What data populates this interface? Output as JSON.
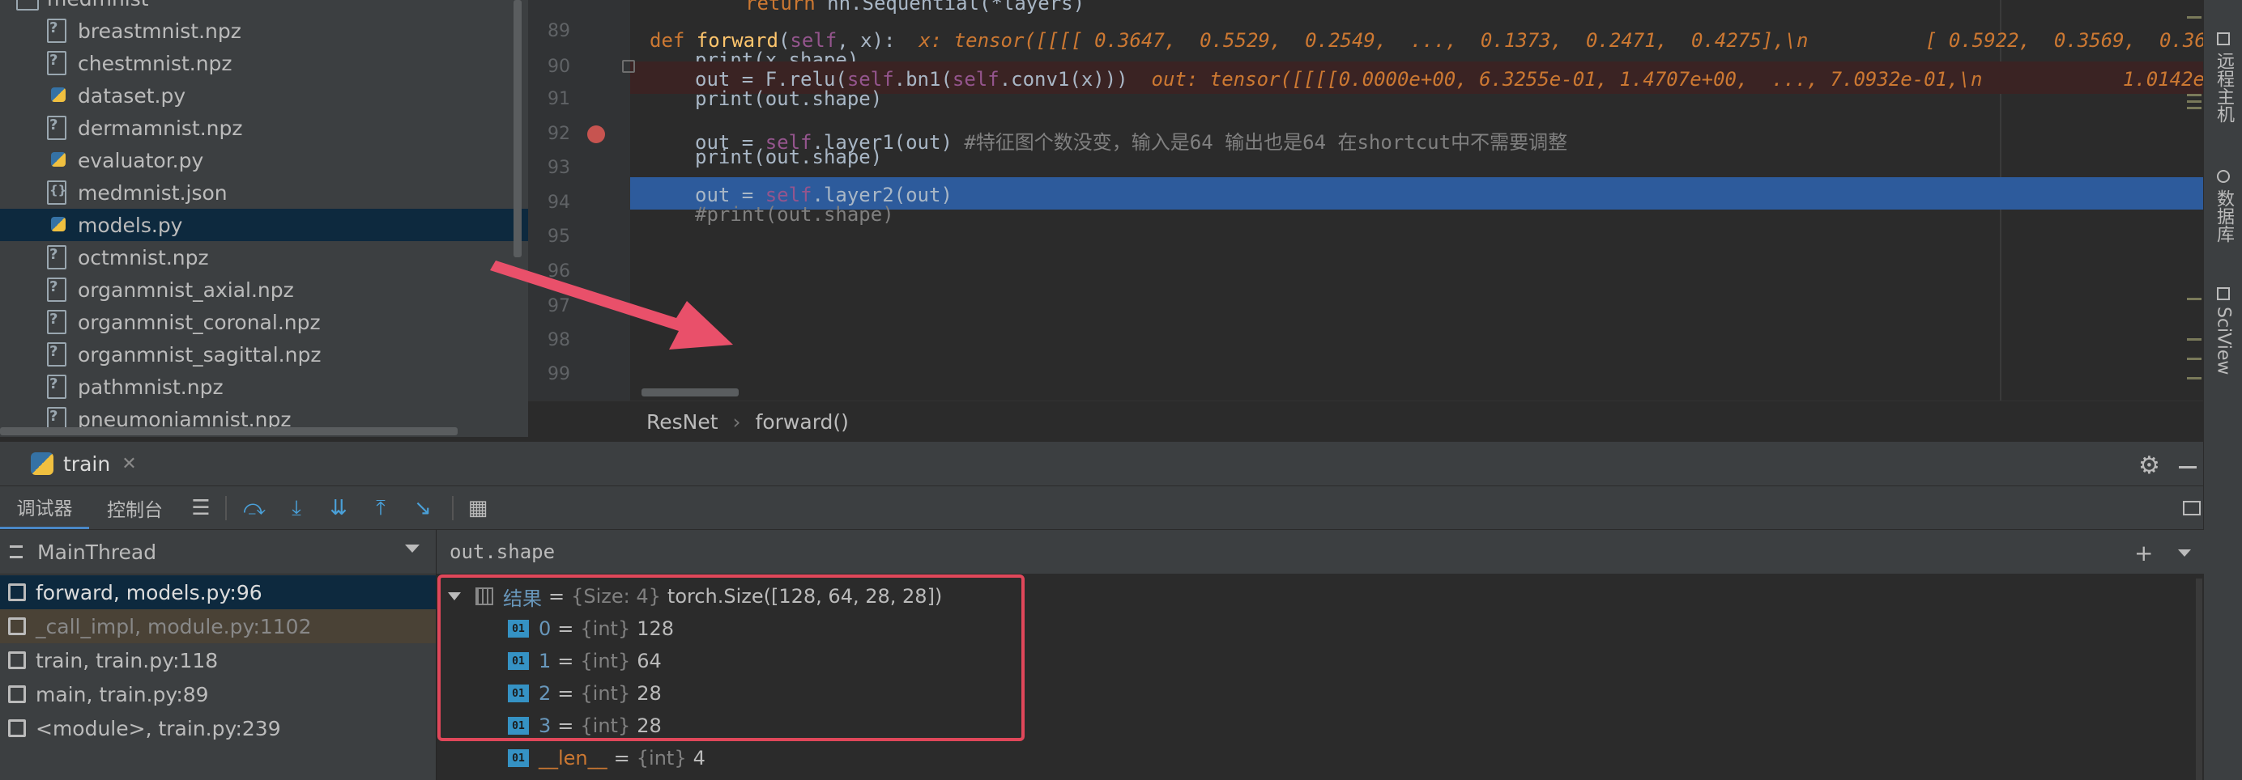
{
  "project_tree": {
    "folder": "medmnist",
    "files": [
      {
        "name": "breastmnist.npz",
        "kind": "npz"
      },
      {
        "name": "chestmnist.npz",
        "kind": "npz"
      },
      {
        "name": "dataset.py",
        "kind": "py"
      },
      {
        "name": "dermamnist.npz",
        "kind": "npz"
      },
      {
        "name": "evaluator.py",
        "kind": "py"
      },
      {
        "name": "medmnist.json",
        "kind": "json"
      },
      {
        "name": "models.py",
        "kind": "py",
        "selected": true
      },
      {
        "name": "octmnist.npz",
        "kind": "npz"
      },
      {
        "name": "organmnist_axial.npz",
        "kind": "npz"
      },
      {
        "name": "organmnist_coronal.npz",
        "kind": "npz"
      },
      {
        "name": "organmnist_sagittal.npz",
        "kind": "npz"
      },
      {
        "name": "pathmnist.npz",
        "kind": "npz"
      },
      {
        "name": "pneumoniamnist.npz",
        "kind": "npz"
      }
    ]
  },
  "editor": {
    "lines": [
      {
        "n": "89",
        "text": "return nn.Sequential(*layers)"
      },
      {
        "n": "90",
        "text": "def forward(self, x):",
        "inlay": "x: tensor([[[[ 0.3647,  0.5529,  0.2549,  ...,  0.1373,  0.2471,  0.4275],\\n          [ 0.5922,  0.3569,  0.364"
      },
      {
        "n": "91",
        "text": "print(x.shape)"
      },
      {
        "n": "92",
        "text": "out = F.relu(self.bn1(self.conv1(x)))",
        "inlay": "out: tensor([[[[0.0000e+00, 6.3255e-01, 1.4707e+00,  ..., 7.0932e-01,\\n            1.0142e-0"
      },
      {
        "n": "93",
        "text": "print(out.shape)"
      },
      {
        "n": "94",
        "text": ""
      },
      {
        "n": "95",
        "text": "out = self.layer1(out)",
        "comment": "#特征图个数没变，输入是64 输出也是64 在shortcut中不需要调整"
      },
      {
        "n": "96",
        "text": "print(out.shape)"
      },
      {
        "n": "97",
        "text": ""
      },
      {
        "n": "98",
        "text": "out = self.layer2(out)"
      },
      {
        "n": "99",
        "text": "#print(out.shape)"
      }
    ],
    "breadcrumb": [
      "ResNet",
      "forward()"
    ]
  },
  "right_stripe": {
    "tabs": [
      "远程主机",
      "数据库",
      "SciView"
    ]
  },
  "debug": {
    "run_tab": "train",
    "tabs": {
      "debugger": "调试器",
      "console": "控制台"
    },
    "thread": "MainThread",
    "frames": [
      {
        "label": "forward, models.py:96",
        "state": "active"
      },
      {
        "label": "_call_impl, module.py:1102",
        "state": "library"
      },
      {
        "label": "train, train.py:118",
        "state": "normal"
      },
      {
        "label": "main, train.py:89",
        "state": "normal"
      },
      {
        "label": "<module>, train.py:239",
        "state": "normal"
      }
    ],
    "watch_expression": "out.shape",
    "result": {
      "name": "结果",
      "type": "{Size: 4}",
      "value": "torch.Size([128, 64, 28, 28])"
    },
    "items": [
      {
        "name": "0",
        "type": "{int}",
        "value": "128"
      },
      {
        "name": "1",
        "type": "{int}",
        "value": "64"
      },
      {
        "name": "2",
        "type": "{int}",
        "value": "28"
      },
      {
        "name": "3",
        "type": "{int}",
        "value": "28"
      }
    ],
    "len_item": {
      "name": "__len__",
      "type": "{int}",
      "value": "4"
    },
    "int_badge": "01"
  },
  "colors": {
    "accent": "#2d5b9c",
    "annotation": "#e0475a",
    "breakpoint": "#c75450"
  },
  "icons": [
    "python-file-icon",
    "npz-file-icon",
    "json-file-icon",
    "step-over-icon",
    "step-into-icon",
    "step-out-icon",
    "settings-icon"
  ]
}
